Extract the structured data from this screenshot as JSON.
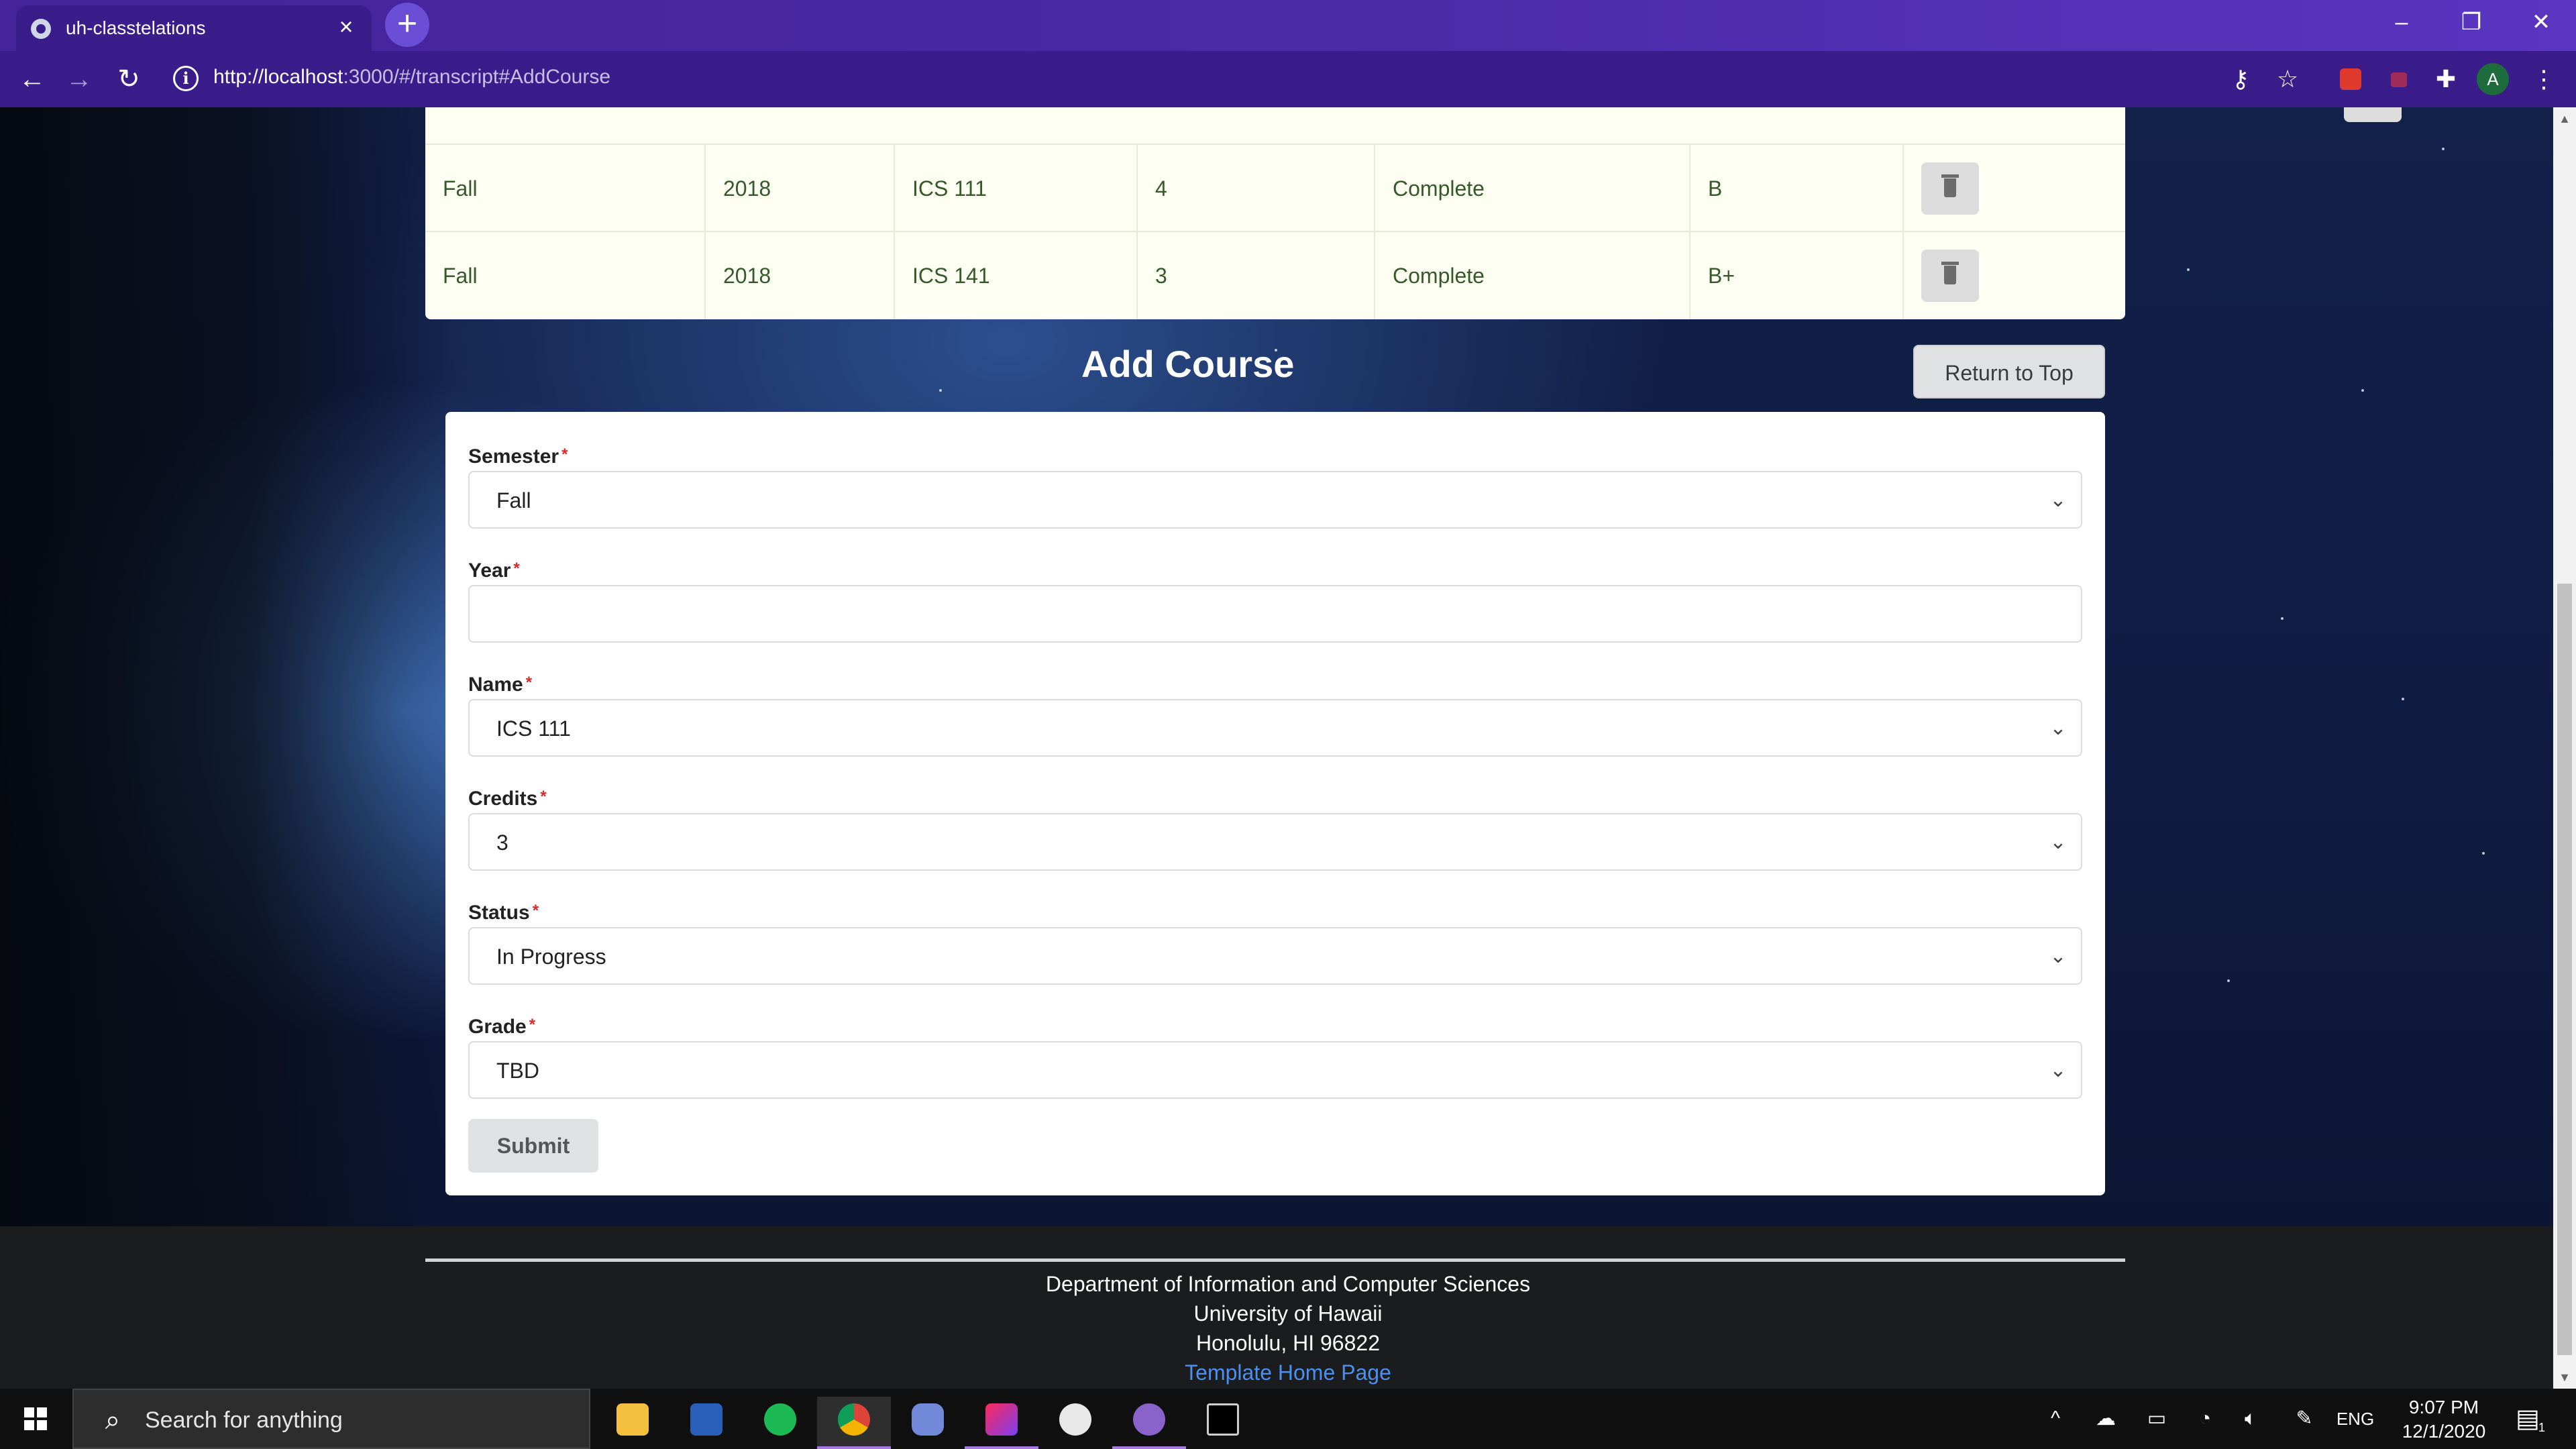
{
  "browser": {
    "tab_title": "uh-classtelations",
    "url_host": "http://localhost",
    "url_rest": ":3000/#/transcript#AddCourse",
    "profile_initial": "A"
  },
  "transcript_rows": [
    {
      "semester": "Fall",
      "year": "2018",
      "name": "ICS 111",
      "credits": "4",
      "status": "Complete",
      "grade": "B"
    },
    {
      "semester": "Fall",
      "year": "2018",
      "name": "ICS 141",
      "credits": "3",
      "status": "Complete",
      "grade": "B+"
    }
  ],
  "add_course": {
    "heading": "Add Course",
    "return_to_top": "Return to Top",
    "required_mark": "*",
    "semester": {
      "label": "Semester",
      "value": "Fall"
    },
    "year": {
      "label": "Year",
      "value": ""
    },
    "name": {
      "label": "Name",
      "value": "ICS 111"
    },
    "credits": {
      "label": "Credits",
      "value": "3"
    },
    "status": {
      "label": "Status",
      "value": "In Progress"
    },
    "grade": {
      "label": "Grade",
      "value": "TBD"
    },
    "submit": "Submit"
  },
  "footer": {
    "line1": "Department of Information and Computer Sciences",
    "line2": "University of Hawaii",
    "line3": "Honolulu, HI 96822",
    "link": "Template Home Page"
  },
  "taskbar": {
    "search_placeholder": "Search for anything",
    "language": "ENG",
    "time": "9:07 PM",
    "date": "12/1/2020",
    "notification_count": "1"
  },
  "colors": {
    "chrome": "#3a1c8a",
    "table_text": "#37592a",
    "required": "#db2828",
    "footer_link": "#4b8ff0"
  }
}
